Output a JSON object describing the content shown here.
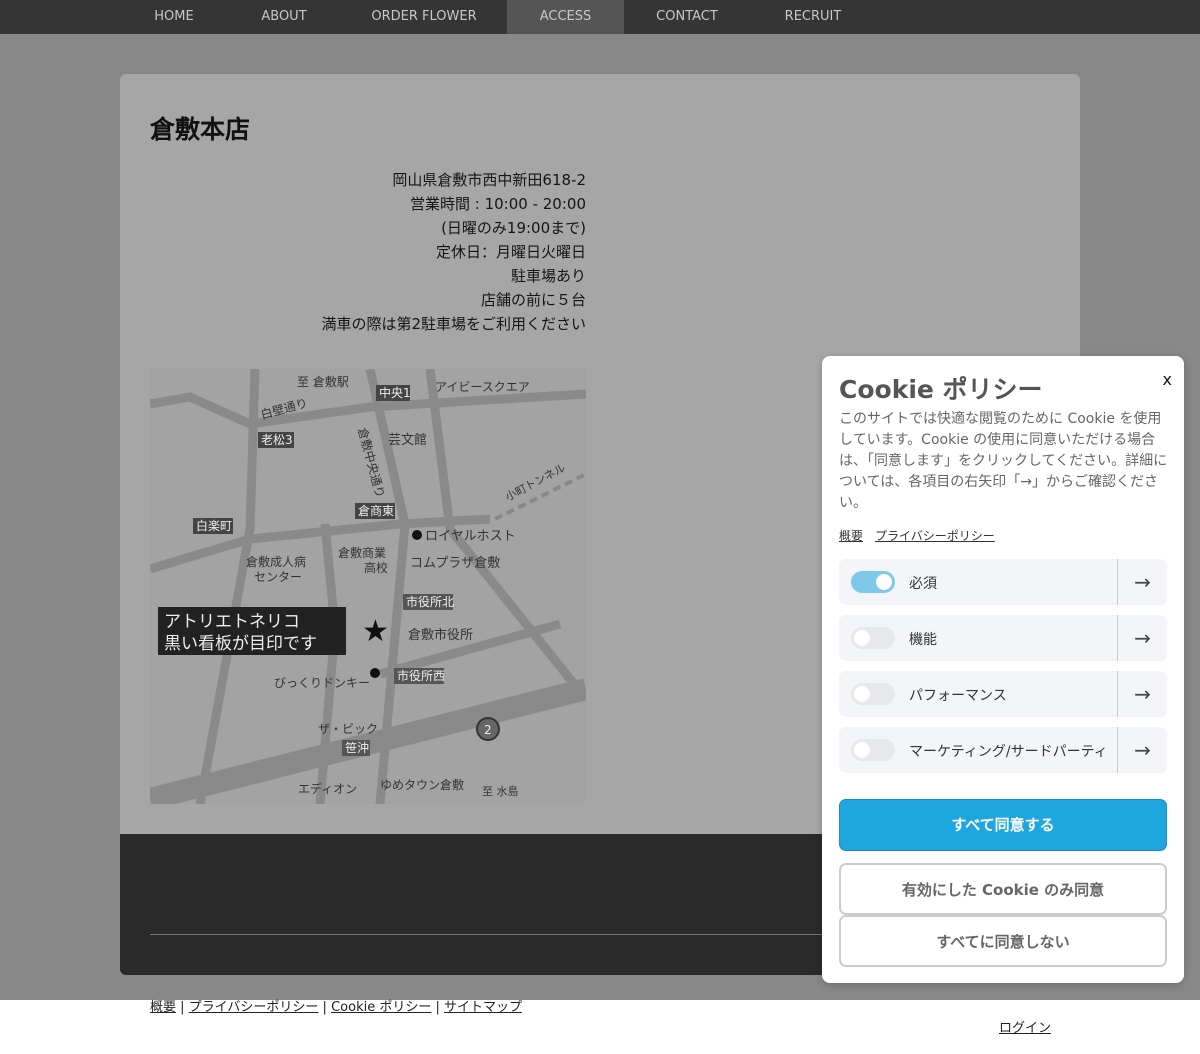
{
  "nav": [
    "HOME",
    "ABOUT",
    "ORDER FLOWER",
    "ACCESS",
    "CONTACT",
    "RECRUIT"
  ],
  "store": {
    "title": "倉敷本店",
    "lines": [
      "岡山県倉敷市西中新田618-2",
      "営業時間 : 10:00 - 20:00",
      "(日曜のみ19:00まで)",
      "定休日：月曜日火曜日",
      "駐車場あり",
      "店舗の前に５台",
      "満車の際は第2駐車場をご利用ください"
    ]
  },
  "map": {
    "labels": [
      "至 倉敷駅",
      "中央1",
      "アイビースクエア",
      "白壁通り",
      "老松3",
      "倉敷中央通り",
      "芸文館",
      "小町トンネル",
      "倉商東",
      "白楽町",
      "ロイヤルホスト",
      "倉敷成人病",
      "センター",
      "倉敷商業",
      "高校",
      "コムプラザ倉敷",
      "市役所北",
      "アトリエトネリコ",
      "黒い看板が目印です",
      "倉敷市役所",
      "市役所西",
      "びっくりドンキー",
      "ザ・ビック",
      "笹沖",
      "エディオン",
      "ゆめタウン倉敷",
      "至 水島",
      "2"
    ]
  },
  "footer": {
    "links": [
      "概要",
      "プライバシーポリシー",
      "Cookie ポリシー",
      "サイトマップ"
    ],
    "login": "ログイン"
  },
  "cookie": {
    "title": "Cookie ポリシー",
    "close": "x",
    "description": "このサイトでは快適な閲覧のために Cookie を使用しています。Cookie の使用に同意いただける場合は、「同意します」をクリックしてください。詳細については、各項目の右矢印「→」からご確認ください。",
    "links": [
      "概要",
      "プライバシーポリシー"
    ],
    "categories": [
      {
        "label": "必須",
        "on": true
      },
      {
        "label": "機能",
        "on": false
      },
      {
        "label": "パフォーマンス",
        "on": false
      },
      {
        "label": "マーケティング/サードパーティ",
        "on": false
      }
    ],
    "arrow": "→",
    "accept_all": "すべて同意する",
    "accept_selected": "有効にした Cookie のみ同意",
    "reject_all": "すべてに同意しない",
    "accent": "#1ea7de"
  }
}
